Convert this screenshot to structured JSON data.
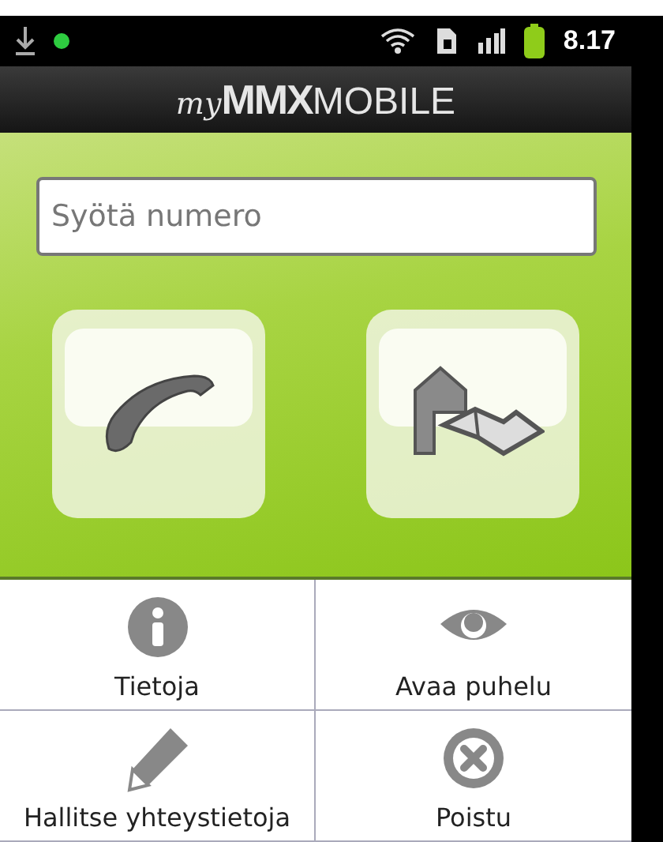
{
  "status_bar": {
    "time": "8.17"
  },
  "header": {
    "logo": {
      "prefix": "my",
      "brand": "MMX",
      "suffix": "MOBILE"
    }
  },
  "number_field": {
    "placeholder": "Syötä numero"
  },
  "actions": [
    {
      "kind": "call"
    },
    {
      "kind": "contacts"
    }
  ],
  "menu": [
    {
      "kind": "info",
      "label": "Tietoja"
    },
    {
      "kind": "eye",
      "label": "Avaa puhelu"
    },
    {
      "kind": "pencil",
      "label": "Hallitse yhteystietoja"
    },
    {
      "kind": "close",
      "label": "Poistu"
    }
  ]
}
